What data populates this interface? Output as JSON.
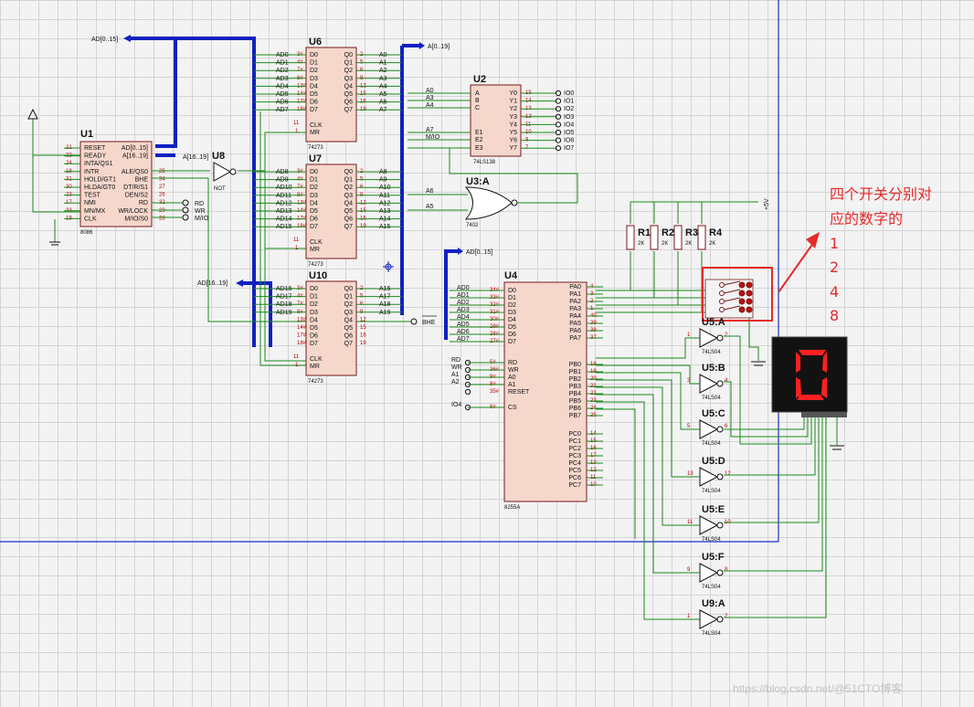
{
  "chips": {
    "u1": {
      "ref": "U1",
      "part": "8086",
      "left_pins": [
        "RESET",
        "READY",
        "INTA/QS1",
        "INTR",
        "HOLD/GT1",
        "HLDA/GT0",
        "TEST",
        "NMI",
        "MN/MX",
        "CLK"
      ],
      "left_nums": [
        "21",
        "22",
        "24",
        "18",
        "31",
        "30",
        "23",
        "17",
        "33",
        "19"
      ],
      "right_pins": [
        "AD[0..15]",
        "A[16..19]",
        "",
        "ALE/QS0",
        "BHE",
        "DT/R/S1",
        "DEN/S2",
        "RD",
        "WR/LOCK",
        "M/IO/S0"
      ],
      "right_nums": [
        "",
        "",
        "",
        "25",
        "34",
        "27",
        "26",
        "32",
        "29",
        "28"
      ]
    },
    "u6": {
      "ref": "U6",
      "part": "74273",
      "d": [
        "D0",
        "D1",
        "D2",
        "D3",
        "D4",
        "D5",
        "D6",
        "D7"
      ],
      "q": [
        "Q0",
        "Q1",
        "Q2",
        "Q3",
        "Q4",
        "Q5",
        "Q6",
        "Q7"
      ],
      "din": [
        "AD0",
        "AD1",
        "AD2",
        "AD3",
        "AD4",
        "AD5",
        "AD6",
        "AD7"
      ],
      "qout": [
        "A0",
        "A1",
        "A2",
        "A3",
        "A4",
        "A5",
        "A6",
        "A7"
      ],
      "dnum": [
        "3",
        "4",
        "7",
        "8",
        "13",
        "14",
        "17",
        "18"
      ],
      "qnum": [
        "2",
        "5",
        "6",
        "9",
        "12",
        "15",
        "16",
        "19"
      ],
      "clk": "CLK",
      "mr": "MR"
    },
    "u7": {
      "ref": "U7",
      "part": "74273",
      "din": [
        "AD8",
        "AD9",
        "AD10",
        "AD11",
        "AD12",
        "AD13",
        "AD14",
        "AD15"
      ],
      "qout": [
        "A8",
        "A9",
        "A10",
        "A11",
        "A12",
        "A13",
        "A14",
        "A15"
      ]
    },
    "u10": {
      "ref": "U10",
      "part": "74273",
      "din": [
        "AD16",
        "AD17",
        "AD18",
        "AD19",
        "",
        "",
        "",
        ""
      ],
      "qout": [
        "A16",
        "A17",
        "A18",
        "A19",
        "",
        "",
        "",
        ""
      ]
    },
    "u8": {
      "ref": "U8",
      "part": "NOT"
    },
    "u2": {
      "ref": "U2",
      "part": "74LS138",
      "in": [
        "A",
        "B",
        "C",
        "E1",
        "E2",
        "E3"
      ],
      "in_nets": [
        "A0",
        "A3",
        "A4",
        "A7",
        "M/IO",
        ""
      ],
      "out": [
        "Y0",
        "Y1",
        "Y2",
        "Y3",
        "Y4",
        "Y5",
        "Y6",
        "Y7"
      ],
      "out_nets": [
        "IO0",
        "IO1",
        "IO2",
        "IO3",
        "IO4",
        "IO5",
        "IO6",
        "IO7"
      ],
      "out_nums": [
        "15",
        "14",
        "13",
        "12",
        "11",
        "10",
        "9",
        "7"
      ]
    },
    "u3": {
      "ref": "U3:A",
      "part": "7402",
      "in_nets": [
        "A6",
        "A5"
      ]
    },
    "u4": {
      "ref": "U4",
      "part": "8255A",
      "left": [
        "D0",
        "D1",
        "D2",
        "D3",
        "D4",
        "D5",
        "D6",
        "D7",
        "RD",
        "WR",
        "A0",
        "A1",
        "RESET",
        "CS"
      ],
      "left_nets": [
        "AD0",
        "AD1",
        "AD2",
        "AD3",
        "AD4",
        "AD5",
        "AD6",
        "AD7",
        "RD",
        "WR",
        "A1",
        "A2",
        "",
        "IO4"
      ],
      "left_nums": [
        "34",
        "33",
        "32",
        "31",
        "30",
        "29",
        "28",
        "27",
        "5",
        "36",
        "9",
        "8",
        "35",
        "6"
      ],
      "right": [
        "PA0",
        "PA1",
        "PA2",
        "PA3",
        "PA4",
        "PA5",
        "PA6",
        "PA7",
        "PB0",
        "PB1",
        "PB2",
        "PB3",
        "PB4",
        "PB5",
        "PB6",
        "PB7",
        "PC0",
        "PC1",
        "PC2",
        "PC3",
        "PC4",
        "PC5",
        "PC6",
        "PC7"
      ],
      "right_nums": [
        "4",
        "3",
        "2",
        "1",
        "40",
        "39",
        "38",
        "37",
        "18",
        "19",
        "20",
        "21",
        "22",
        "23",
        "24",
        "25",
        "14",
        "15",
        "16",
        "17",
        "13",
        "12",
        "11",
        "10"
      ]
    },
    "inverters": [
      {
        "ref": "U5:A",
        "part": "74LS04",
        "in": "1",
        "out": "2"
      },
      {
        "ref": "U5:B",
        "part": "74LS04",
        "in": "3",
        "out": "4"
      },
      {
        "ref": "U5:C",
        "part": "74LS04",
        "in": "5",
        "out": "6"
      },
      {
        "ref": "U5:D",
        "part": "74LS04",
        "in": "13",
        "out": "12"
      },
      {
        "ref": "U5:E",
        "part": "74LS04",
        "in": "11",
        "out": "10"
      },
      {
        "ref": "U5:F",
        "part": "74LS04",
        "in": "9",
        "out": "8"
      },
      {
        "ref": "U9:A",
        "part": "74LS04",
        "in": "1",
        "out": "2"
      }
    ],
    "resistors": [
      {
        "ref": "R1",
        "value": "2K"
      },
      {
        "ref": "R2",
        "value": "2K"
      },
      {
        "ref": "R3",
        "value": "2K"
      },
      {
        "ref": "R4",
        "value": "2K"
      }
    ]
  },
  "nets": {
    "ad_bus_top": "AD[0..15]",
    "a16_bus": "AD[16..19]",
    "a_bus": "A[0..19]",
    "ad_bus_8255": "AD[0..15]",
    "a1619": "A[16..19]",
    "u1_out": [
      "RD",
      "WR",
      "M/IO"
    ],
    "bhe": "BHE",
    "power": "+5V"
  },
  "display": {
    "digit": "0",
    "segment_color": "#ff2020"
  },
  "annotation": {
    "title_line1": "四个开关分别对",
    "title_line2": "应的数字的",
    "values": [
      "1",
      "2",
      "4",
      "8"
    ]
  },
  "watermark": "https://blog.csdn.net/@51CTO博客",
  "colors": {
    "wire": "#1a8a1a",
    "bus": "#1020c0",
    "chip_fill": "#f5d7cc",
    "chip_border": "#7a1a1a",
    "annotation": "#e52a2a",
    "sheet_border": "#1a2fd0"
  }
}
